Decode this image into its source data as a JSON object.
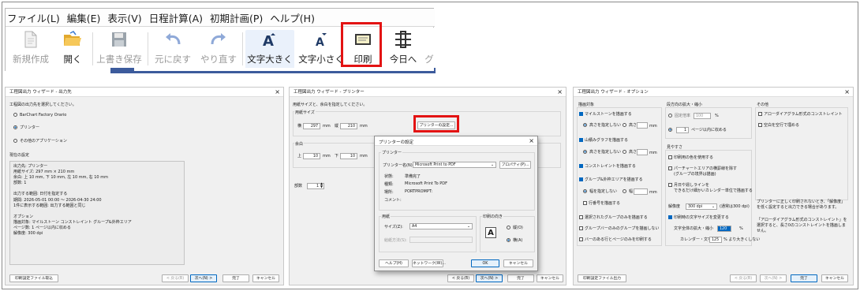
{
  "menu": [
    "ファイル(L)",
    "編集(E)",
    "表示(V)",
    "日程計算(A)",
    "初期計画(P)",
    "ヘルプ(H)"
  ],
  "toolbar": [
    {
      "label": "新規作成",
      "icon": "new-file-icon",
      "enabled": false
    },
    {
      "label": "開く",
      "icon": "open-folder-icon",
      "enabled": true
    },
    {
      "label": "上書き保存",
      "icon": "save-disk-icon",
      "enabled": false
    },
    {
      "label": "元に戻す",
      "icon": "undo-icon",
      "enabled": false
    },
    {
      "label": "やり直す",
      "icon": "redo-icon",
      "enabled": false
    },
    {
      "label": "文字大きく",
      "icon": "font-larger-icon",
      "enabled": true
    },
    {
      "label": "文字小さく",
      "icon": "font-smaller-icon",
      "enabled": true
    },
    {
      "label": "印刷",
      "icon": "printer-icon",
      "enabled": true
    },
    {
      "label": "今日へ",
      "icon": "today-icon",
      "enabled": true
    },
    {
      "label": "グ",
      "icon": "",
      "enabled": true
    }
  ],
  "colors": {
    "highlight": "#e31313",
    "accent": "#0067c0",
    "strip": "#3c5b9c"
  },
  "d1": {
    "title": "工程図出力 ウィザード - 出力先",
    "prompt": "工程図の出力先を選択してください。",
    "options": [
      "BarChart Factory Orario",
      "プリンター",
      "その他のアプリケーション"
    ],
    "selected_index": 1,
    "current_heading": "現在の設定",
    "current_lines": [
      "出力先: プリンター",
      "用紙サイズ: 297 mm × 210 mm",
      "余白: 上 10 mm, 下 10 mm, 左 10 mm, 右 10 mm",
      "部数: 1",
      "",
      "出力する範囲: 日付を指定する",
      "期間: 2026-05-01 00:00 ～ 2026-04-30 24:00",
      "1件に表示する範囲: 出力する範囲と同じ",
      "",
      "オプション",
      "描画対象: マイルストーン コンストレイント グループ&外枠エリア",
      "ページ数: 1 ページ以内に収める",
      "解像度: 300 dpi"
    ],
    "btn_load": "印刷設定ファイル取込",
    "btn_back": "< 戻る(B)",
    "btn_next": "次へ(N) >",
    "btn_finish": "完了",
    "btn_cancel": "キャンセル"
  },
  "d2": {
    "title": "工程図出力 ウィザード - プリンター",
    "prompt": "用紙サイズと、余白を指定してください。",
    "paper_size_label": "用紙サイズ",
    "width_label": "横",
    "width": "297",
    "height_label": "縦",
    "height": "210",
    "unit": "mm",
    "printer_settings_btn": "プリンターの設定...",
    "margin_label": "余白",
    "top_label": "上",
    "top": "10",
    "bottom_label": "下",
    "bottom": "10",
    "copies_label": "部数",
    "copies": "1",
    "btn_back": "< 戻る(B)",
    "btn_next": "次へ(N) >",
    "btn_finish": "完了",
    "btn_cancel": "キャンセル"
  },
  "ps": {
    "title": "プリンターの設定",
    "printer_group": "プリンター",
    "printer_name_label": "プリンター名(N):",
    "printer_name": "Microsoft Print to PDF",
    "properties_btn": "プロパティ(P)...",
    "status_label": "状態:",
    "status": "準備完了",
    "type_label": "種類:",
    "type": "Microsoft Print To PDF",
    "location_label": "場所:",
    "location": "PORTPROMPT:",
    "comment_label": "コメント:",
    "paper_group": "用紙",
    "size_label": "サイズ(Z):",
    "size": "A4",
    "source_label": "給紙方法(S):",
    "orientation_group": "印刷の向き",
    "portrait": "縦(O)",
    "landscape": "横(A)",
    "help_btn": "ヘルプ(H)",
    "network_btn": "ネットワーク(W)...",
    "ok_btn": "OK",
    "cancel_btn": "キャンセル"
  },
  "d3": {
    "title": "工程図出力 ウィザード - オプション",
    "draw_target": "描画対象",
    "milestone": "マイルストーンを描画する",
    "no_height": "高さを指定しない",
    "height": "高さ",
    "mm": "mm",
    "mountain": "山積みグラフを描画する",
    "constraint": "コンストレイントを描画する",
    "group_area": "グループ&外枠エリアを描画する",
    "no_width": "幅を指定しない",
    "width": "幅",
    "row_number": "行番号を描画する",
    "selected_group": "選択されたグループのみを描画する",
    "group_bars_only": "グループバーのみのグループを描画しない",
    "bars_pages": "バーのある行とページのみを印刷する",
    "zoom_group": "段方向の拡大・縮小",
    "fixed_ratio": "固定倍率",
    "ratio": "100",
    "pct": "%",
    "fit_pages": "1",
    "fit_pages_label": "ページ以内に収める",
    "visibility_group": "見やすさ",
    "print_colors": "印刷用の色を使用する",
    "partial_chart": "パーチャートエリアの横罫線を除す",
    "partial_chart2": "(グループの境界は描画)",
    "month_line": "月日や週しラインを",
    "month_line2": "できるだけ細かいカレンダー単位で描画する",
    "resolution_label": "解像度",
    "resolution": "300 dpi",
    "resolution_note": "(通常は300 dpi)",
    "text_scale": "印刷時の文字サイズを変更する",
    "text_scale_label": "文字全体の拡大・縮小",
    "text_scale_value": "120",
    "cal_text_label": "カレンダー・文字は",
    "cal_text_value": "125",
    "cal_text_note": "% より大きくしない",
    "other_group": "その他",
    "arrow_constraint": "アローダイアグラム形式のコンストレイント",
    "blank_rows": "空白を空行で埋める",
    "note1": "プリンターに正しく印刷されないとき、「解像度」を低く設定すると出力できる場合があります。",
    "note2": "「アローダイアグラム形式のコンストレイント」を選択すると、長さ0のコンストレイントを描画しません。",
    "btn_output": "印刷設定ファイル出力",
    "btn_back": "< 戻る(B)",
    "btn_next": "次へ(N) >",
    "btn_finish": "完了",
    "btn_cancel": "キャンセル"
  }
}
